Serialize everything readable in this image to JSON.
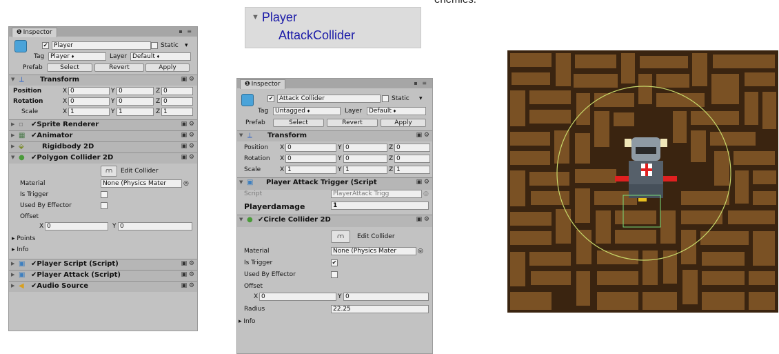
{
  "caption_fragment": "enemies.",
  "hierarchy": {
    "parent": "Player",
    "child": "AttackCollider"
  },
  "left_inspector": {
    "tab_label": "Inspector",
    "object_name": "Player",
    "static_label": "Static",
    "tag_label": "Tag",
    "tag_value": "Player",
    "layer_label": "Layer",
    "layer_value": "Default",
    "prefab_label": "Prefab",
    "prefab_buttons": [
      "Select",
      "Revert",
      "Apply"
    ],
    "transform": {
      "title": "Transform",
      "rows": [
        {
          "label": "Position",
          "x": "0",
          "y": "0",
          "z": "0"
        },
        {
          "label": "Rotation",
          "x": "0",
          "y": "0",
          "z": "0"
        },
        {
          "label": "Scale",
          "x": "1",
          "y": "1",
          "z": "1"
        }
      ]
    },
    "components": [
      "Sprite Renderer",
      "Animator",
      "Rigidbody 2D",
      "Polygon Collider 2D"
    ],
    "edit_collider_label": "Edit Collider",
    "material_label": "Material",
    "material_value": "None (Physics Mater",
    "is_trigger_label": "Is Trigger",
    "used_by_effector_label": "Used By Effector",
    "offset_label": "Offset",
    "offset_x": "0",
    "offset_y": "0",
    "points_label": "Points",
    "info_label": "Info",
    "scripts": [
      "Player Script (Script)",
      "Player Attack (Script)",
      "Audio Source"
    ]
  },
  "right_inspector": {
    "tab_label": "Inspector",
    "object_name": "Attack Collider",
    "static_label": "Static",
    "tag_label": "Tag",
    "tag_value": "Untagged",
    "layer_label": "Layer",
    "layer_value": "Default",
    "prefab_label": "Prefab",
    "prefab_buttons": [
      "Select",
      "Revert",
      "Apply"
    ],
    "transform": {
      "title": "Transform",
      "rows": [
        {
          "label": "Position",
          "x": "0",
          "y": "0",
          "z": "0"
        },
        {
          "label": "Rotation",
          "x": "0",
          "y": "0",
          "z": "0"
        },
        {
          "label": "Scale",
          "x": "1",
          "y": "1",
          "z": "1"
        }
      ]
    },
    "script_title": "Player Attack Trigger (Script",
    "script_label": "Script",
    "script_value": "PlayerAttack Trigg",
    "playerdamage_label": "Playerdamage",
    "playerdamage_value": "1",
    "circle_title": "Circle Collider 2D",
    "edit_collider_label": "Edit Collider",
    "material_label": "Material",
    "material_value": "None (Physics Mater",
    "is_trigger_label": "Is Trigger",
    "used_by_effector_label": "Used By Effector",
    "offset_label": "Offset",
    "offset_x": "0",
    "offset_y": "0",
    "radius_label": "Radius",
    "radius_value": "22.25",
    "info_label": "Info"
  },
  "colors": {
    "panel": "#c2c2c2",
    "header": "#b6b6b6",
    "hierarchy_text": "#1a1aa8",
    "gizmo_circle": "#c8d86a",
    "dirt": "#7a5124"
  }
}
